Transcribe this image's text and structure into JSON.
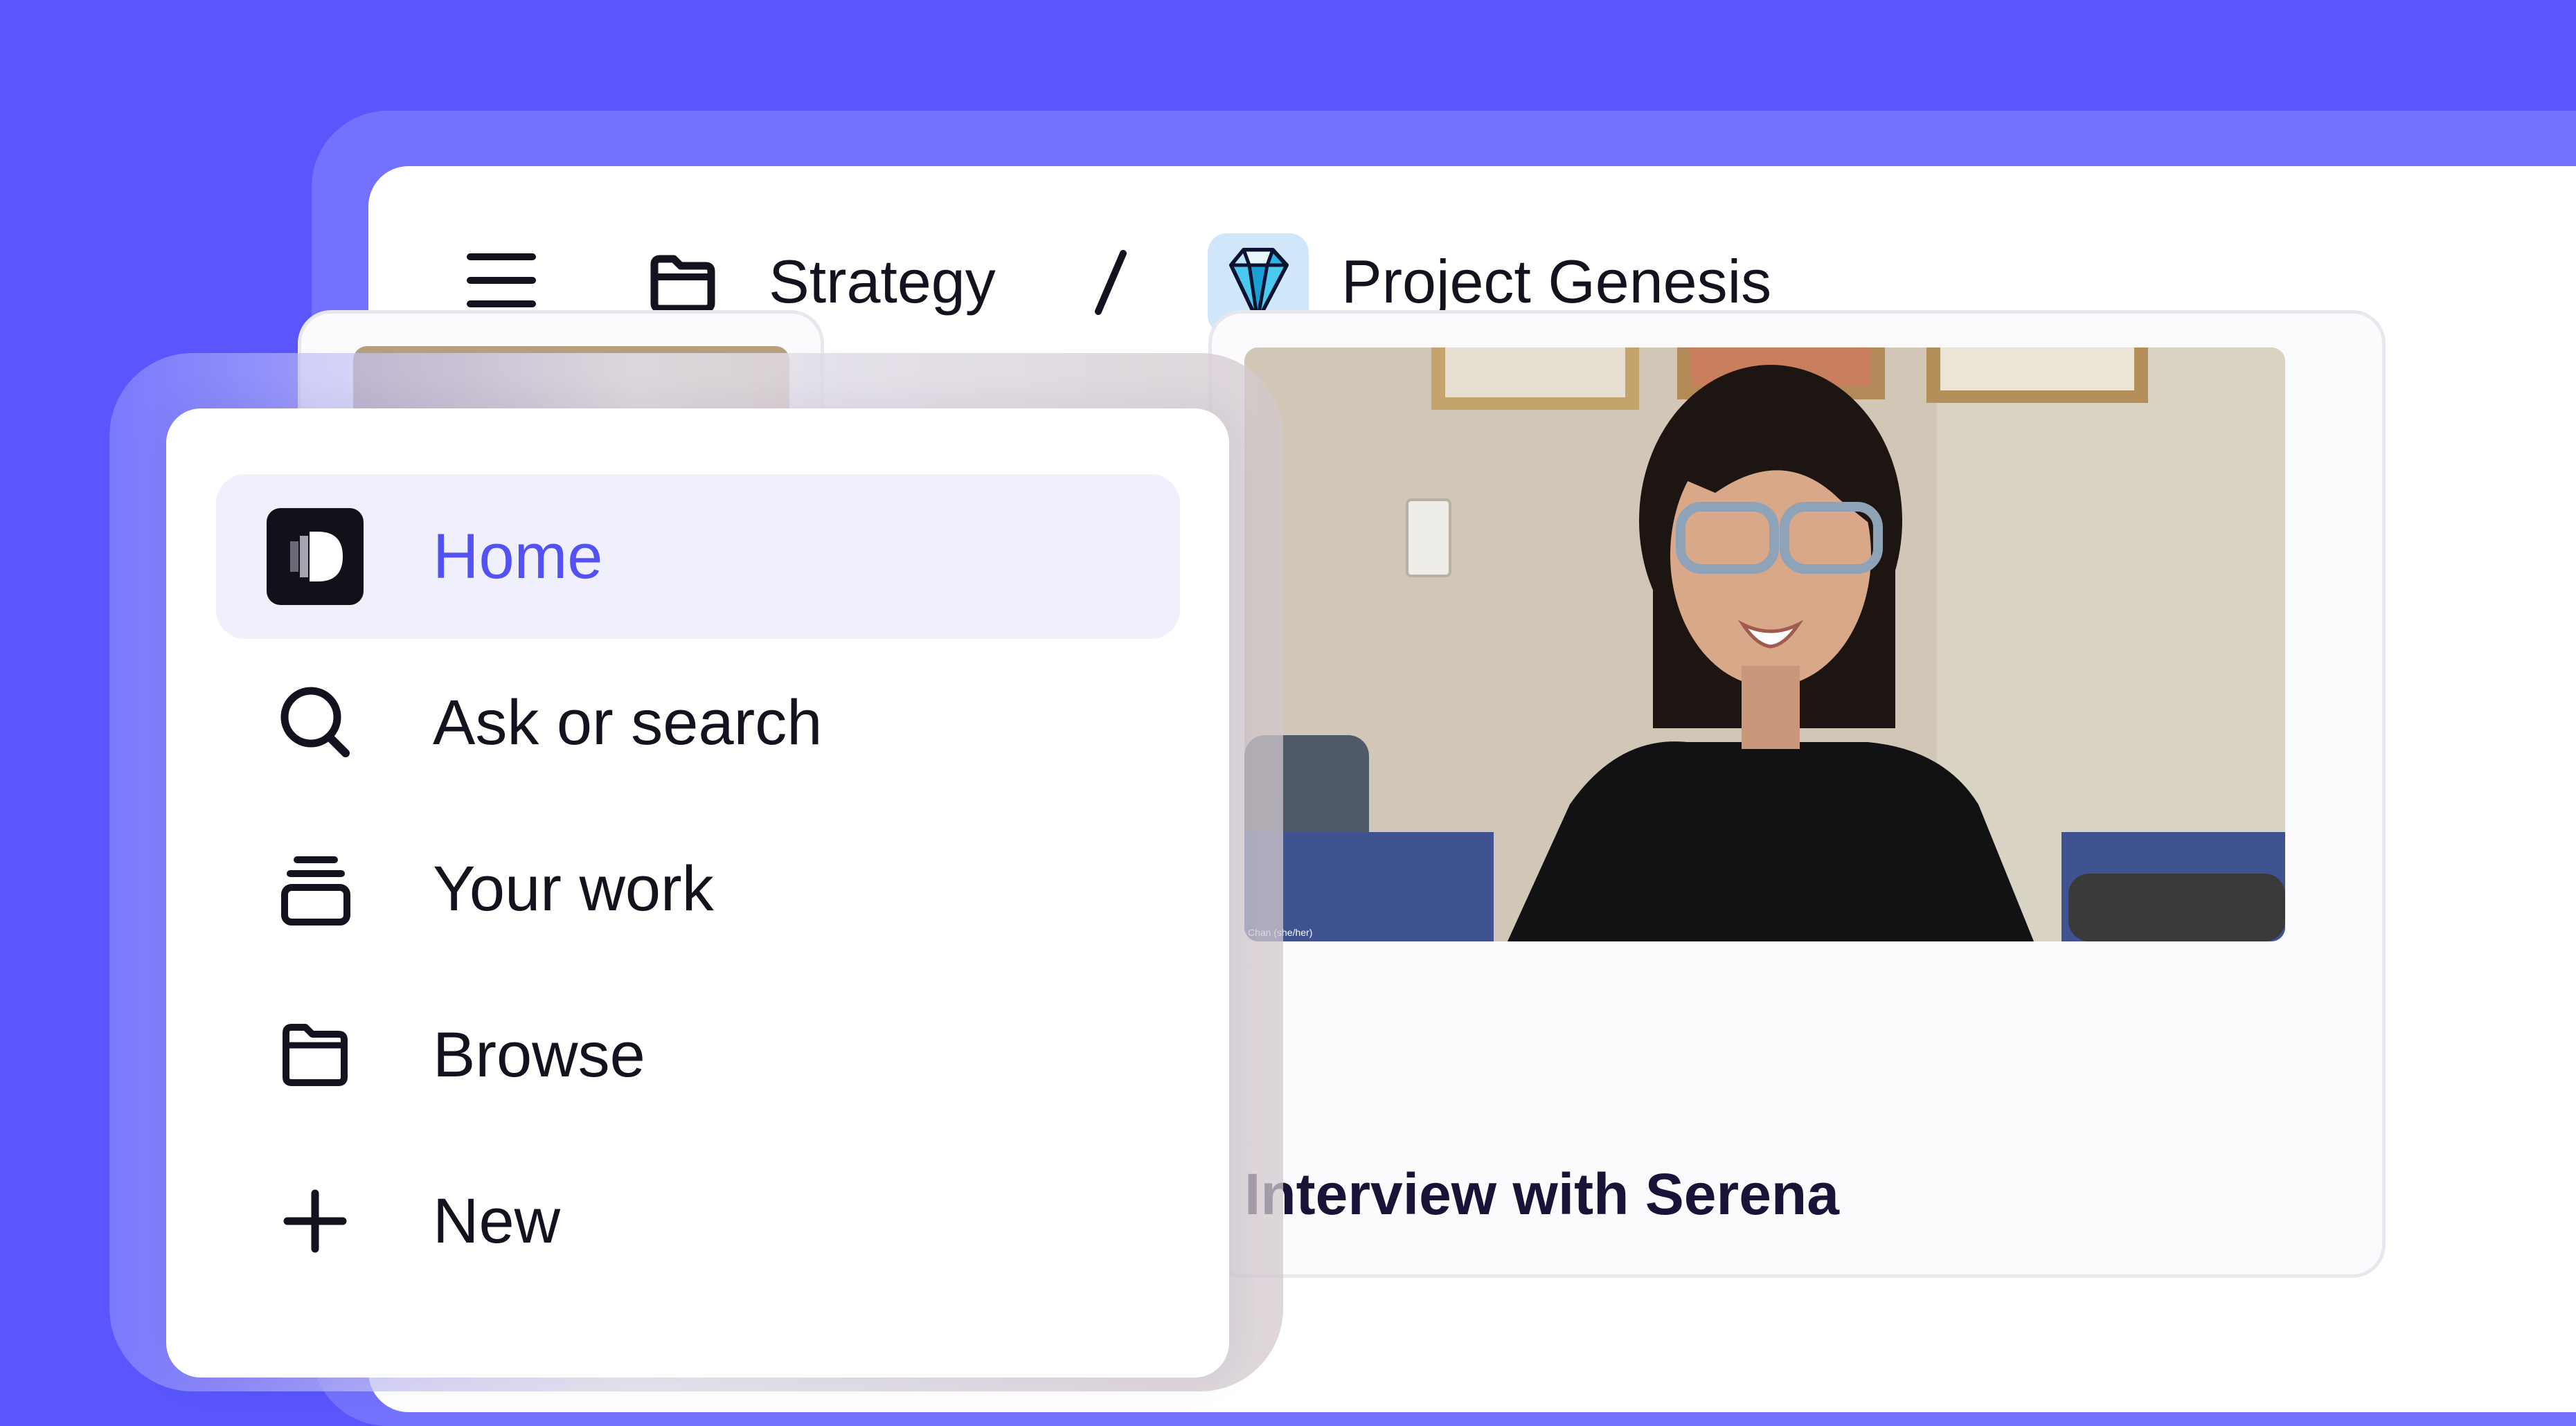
{
  "breadcrumb": {
    "folder": "Strategy",
    "separator": "/",
    "project": "Project Genesis"
  },
  "nav": {
    "items": [
      {
        "label": "Home",
        "icon": "app-logo-icon",
        "active": true
      },
      {
        "label": "Ask or search",
        "icon": "search-icon",
        "active": false
      },
      {
        "label": "Your work",
        "icon": "stack-icon",
        "active": false
      },
      {
        "label": "Browse",
        "icon": "folder-icon",
        "active": false
      },
      {
        "label": "New",
        "icon": "plus-icon",
        "active": false
      }
    ]
  },
  "cards": [
    {
      "title": ""
    },
    {
      "title": "Interview with Serena",
      "video_caption": "Chan (she/her)"
    }
  ],
  "colors": {
    "background": "#5856fc",
    "accent": "#5451f3",
    "active_item_bg": "#f0f0fd",
    "text": "#14121e"
  }
}
